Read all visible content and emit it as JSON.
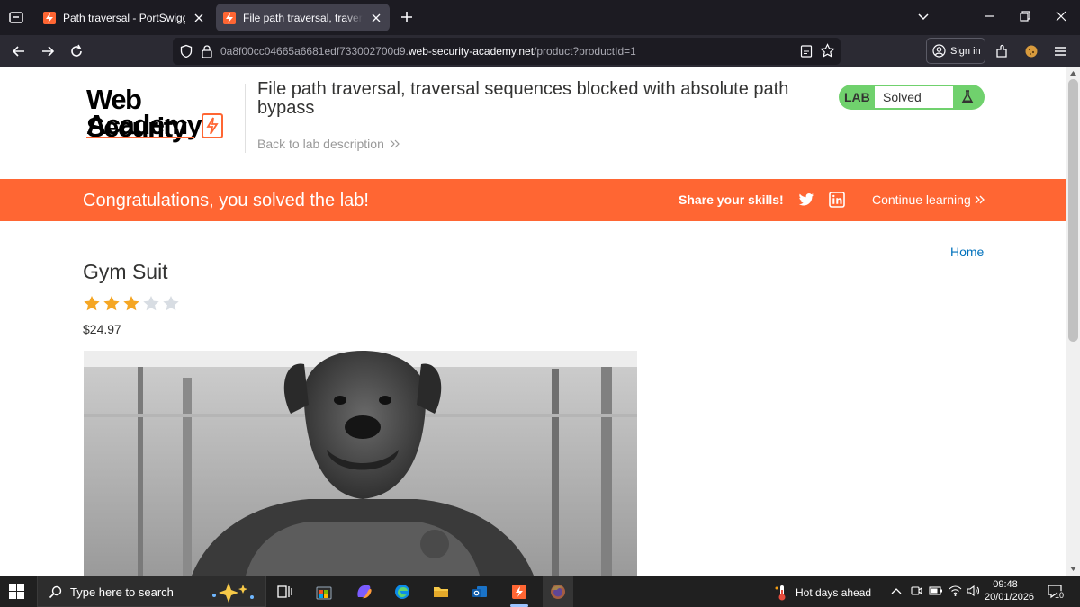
{
  "browser": {
    "tabs": [
      {
        "title": "Path traversal - PortSwigger",
        "active": false
      },
      {
        "title": "File path traversal, traversal sequences blocked with absolute path bypass",
        "active": true
      }
    ],
    "url": {
      "prefix": "0a8f00cc04665a6681edf733002700d9.",
      "host": "web-security-academy.net",
      "path": "/product?productId=1"
    },
    "sign_in_label": "Sign in"
  },
  "page": {
    "logo": {
      "line1": "Web Security",
      "line2": "Academy"
    },
    "lab_title": "File path traversal, traversal sequences blocked with absolute path bypass",
    "back_link": "Back to lab description",
    "lab_status": {
      "badge": "LAB",
      "status": "Solved"
    },
    "banner": {
      "congrats": "Congratulations, you solved the lab!",
      "share": "Share your skills!",
      "continue": "Continue learning"
    },
    "home_link": "Home",
    "product": {
      "name": "Gym Suit",
      "rating": 3,
      "rating_max": 5,
      "price": "$24.97"
    }
  },
  "taskbar": {
    "search_placeholder": "Type here to search",
    "weather": "Hot days ahead",
    "time": "09:48",
    "date": "20/01/2026",
    "notifications": "10"
  },
  "colors": {
    "accent": "#ff6633",
    "solved_green": "#70d16d",
    "link_blue": "#0071bc",
    "star_filled": "#f5a623",
    "star_empty": "#d8dde3"
  }
}
